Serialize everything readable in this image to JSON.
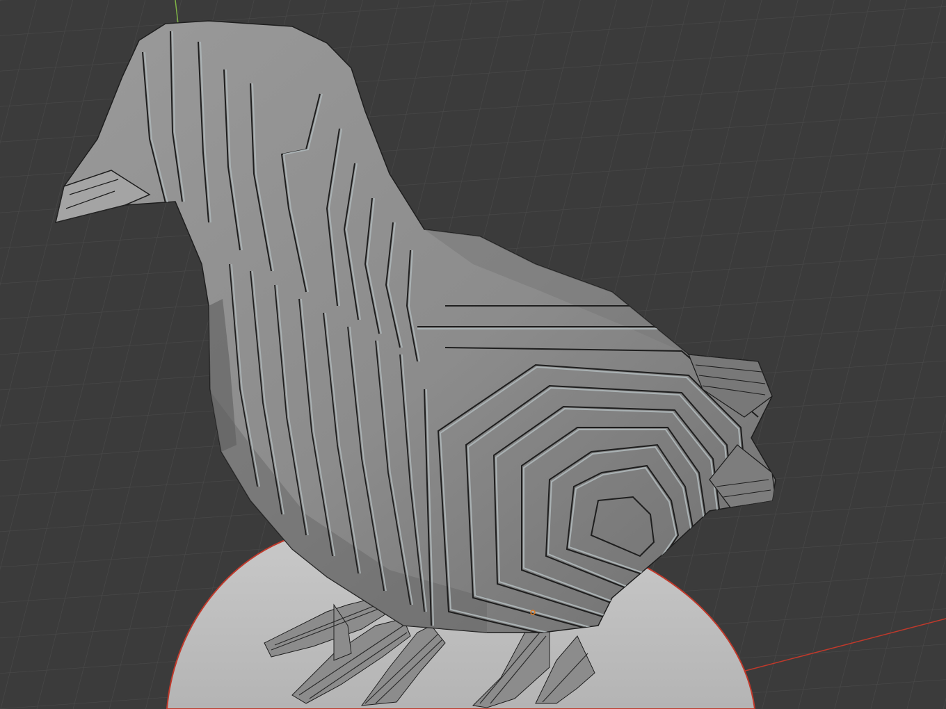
{
  "viewport": {
    "kind": "3d-viewport",
    "background_color": "#3a3a3a",
    "grid_color": "#4b4b4b",
    "grid_line_color_dark": "#303030",
    "x_axis_color": "#c0392b",
    "y_axis_color": "#7fb446"
  },
  "scene": {
    "objects": [
      {
        "name": "bird-sliced-model",
        "color": "#8a8a8a",
        "edge_color": "#1e1e1e",
        "rim_color": "#a6aeb0"
      },
      {
        "name": "pedestal-disc",
        "color": "#bdbdbd",
        "outline_color": "#c0392b"
      }
    ],
    "origin_marker_color": "#e07a20"
  }
}
